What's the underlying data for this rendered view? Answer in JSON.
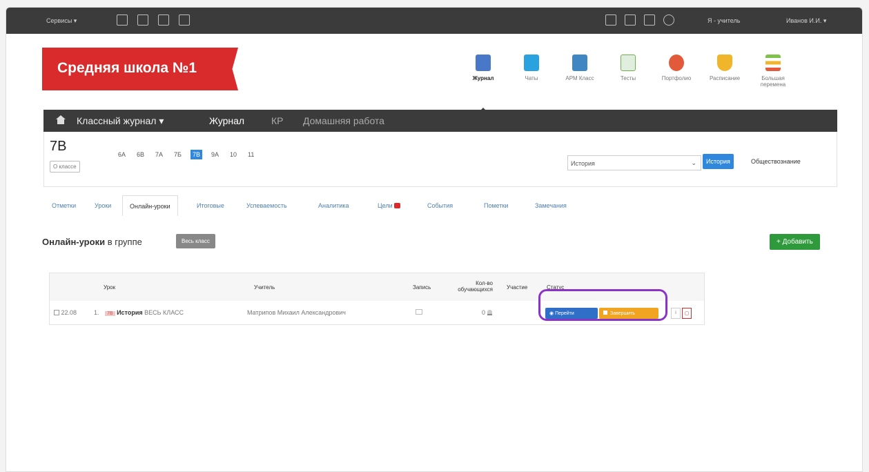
{
  "topbar": {
    "services": "Сервисы ▾",
    "role": "Я - учитель",
    "user": "Иванов И.И. ▾"
  },
  "header": {
    "school_name": "Средняя школа №1",
    "apps": [
      {
        "label": "Журнал",
        "icon": "journal-icon",
        "color": "#4a78c8"
      },
      {
        "label": "Чаты",
        "icon": "chat-icon",
        "color": "#2aa2e0"
      },
      {
        "label": "АРМ Класс",
        "icon": "class-icon",
        "color": "#3f86c2"
      },
      {
        "label": "Тесты",
        "icon": "tests-icon",
        "color": "#6cb34a"
      },
      {
        "label": "Портфолио",
        "icon": "portfolio-icon",
        "color": "#e35a3a"
      },
      {
        "label": "Расписание",
        "icon": "schedule-icon",
        "color": "#f0b52b"
      },
      {
        "label": "Большая перемена",
        "icon": "break-icon",
        "color": "#7fc24b"
      }
    ]
  },
  "journal_nav": {
    "menu": "Классный журнал ▾",
    "items": [
      "Журнал",
      "КР",
      "Домашняя работа"
    ]
  },
  "class_row": {
    "current": "7В",
    "about_button": "О классе",
    "classes": [
      "6А",
      "6В",
      "7А",
      "7Б",
      "7В",
      "9А",
      "10",
      "11"
    ],
    "selected_class": "7В",
    "subject_select": "История",
    "subject_active": "История",
    "subject_other": "Обществознание"
  },
  "tabs": [
    "Отметки",
    "Уроки",
    "Онлайн-уроки",
    "Итоговые",
    "Успеваемость",
    "Аналитика",
    "Цели",
    "События",
    "Пометки",
    "Замечания"
  ],
  "section": {
    "title_bold": "Онлайн-уроки",
    "title_rest": " в группе",
    "group_button": "Весь класс",
    "add_button": "+ Добавить"
  },
  "table": {
    "headers": {
      "lesson": "Урок",
      "teacher": "Учитель",
      "record": "Запись",
      "students_line1": "Кол-во",
      "students_line2": "обучающихся",
      "participants": "Участие",
      "status": "Статус"
    },
    "rows": [
      {
        "time": "22.08",
        "number": "1.",
        "class_badge": "7В",
        "subject": "История",
        "group": "ВЕСЬ КЛАСС",
        "teacher": "Матрипов Михаил Александрович",
        "students": "0",
        "go_label": "Перейти",
        "finish_label": "Завершить"
      }
    ]
  }
}
